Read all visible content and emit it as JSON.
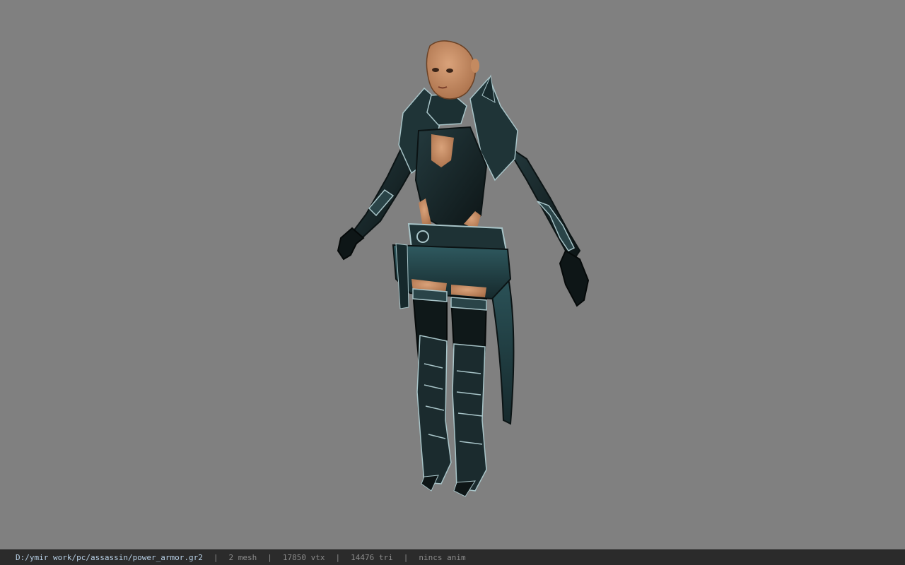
{
  "viewport": {
    "background_color": "#808080",
    "model": {
      "description": "3D character model: assassin in dark teal/black power armor, T-pose",
      "armor_color": "#1b2b2e",
      "trim_color": "#a8c4c8",
      "skin_color": "#c08a62"
    }
  },
  "status_bar": {
    "file_path": "D:/ymir work/pc/assassin/power_armor.gr2",
    "separator": "|",
    "mesh_count": "2 mesh",
    "vertex_count": "17850 vtx",
    "triangle_count": "14476 tri",
    "animation": "nincs anim",
    "path_color": "#b8d0e6",
    "text_color": "#8a8a8a"
  }
}
